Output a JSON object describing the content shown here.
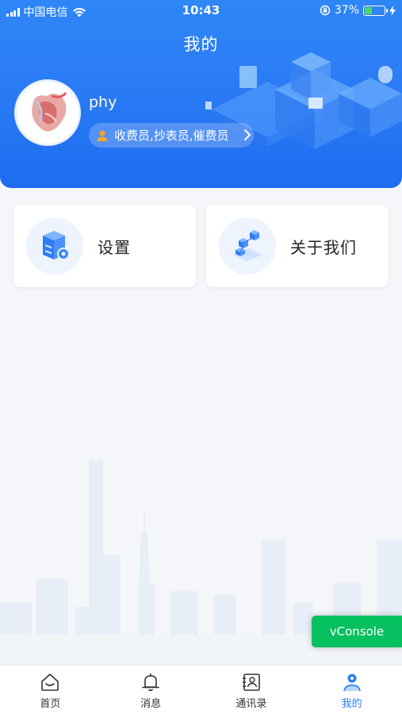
{
  "status_bar": {
    "carrier": "中国电信",
    "time": "10:43",
    "battery": "37%",
    "battery_level": 0.37
  },
  "header": {
    "title": "我的",
    "username": "phy",
    "roles": "收费员,抄表员,催费员"
  },
  "cards": [
    {
      "label": "设置",
      "icon": "server-settings-icon"
    },
    {
      "label": "关于我们",
      "icon": "network-cubes-icon"
    }
  ],
  "vconsole": {
    "label": "vConsole"
  },
  "tabbar": {
    "active": 3,
    "items": [
      {
        "label": "首页",
        "icon": "home-icon"
      },
      {
        "label": "消息",
        "icon": "bell-icon"
      },
      {
        "label": "通讯录",
        "icon": "contacts-icon"
      },
      {
        "label": "我的",
        "icon": "user-icon"
      }
    ]
  },
  "colors": {
    "primary": "#2c7df6",
    "vconsole": "#07c160",
    "battery": "#4cd964"
  }
}
